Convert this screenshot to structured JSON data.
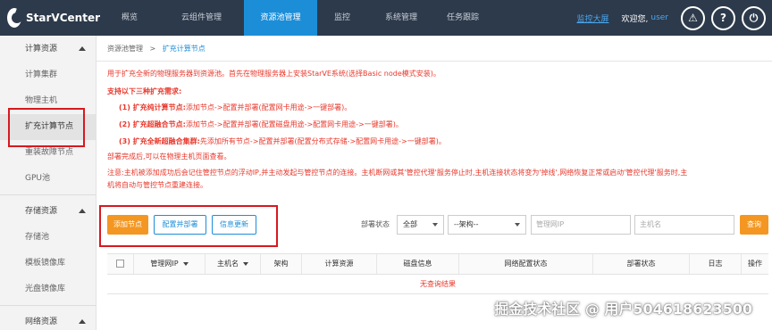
{
  "app": {
    "name": "StarVCenter"
  },
  "nav": [
    "概览",
    "云组件管理",
    "资源池管理",
    "监控",
    "系统管理",
    "任务跟踪"
  ],
  "nav_active_index": 2,
  "header": {
    "screen_link": "监控大屏",
    "welcome": "欢迎您,",
    "user": "user",
    "alert_glyph": "⚠",
    "help_glyph": "?",
    "power_glyph": "⏻"
  },
  "sidebar": {
    "groups": [
      {
        "title": "计算资源",
        "items": [
          "计算集群",
          "物理主机",
          "扩充计算节点",
          "重装故障节点",
          "GPU池"
        ]
      },
      {
        "title": "存储资源",
        "items": [
          "存储池",
          "模板镜像库",
          "光盘镜像库"
        ]
      },
      {
        "title": "网络资源",
        "items": []
      }
    ],
    "active_item": "扩充计算节点"
  },
  "breadcrumb": {
    "root": "资源池管理",
    "sep": ">",
    "current": "扩充计算节点"
  },
  "notes": {
    "intro": "用于扩充全新的物理服务器到资源池。首先在物理服务器上安装StarVE系统(选择Basic node模式安装)。",
    "support": "支持以下三种扩充需求:",
    "items": [
      {
        "label": "(1) 扩充纯计算节点:",
        "text": "添加节点->配置并部署(配置网卡用途->一键部署)。"
      },
      {
        "label": "(2) 扩充超融合节点:",
        "text": "添加节点->配置并部署(配置磁盘用途->配置网卡用途->一键部署)。"
      },
      {
        "label": "(3) 扩充全新超融合集群:",
        "text": "先添加所有节点->配置并部署(配置分布式存储->配置网卡用途->一键部署)。"
      }
    ],
    "after": "部署完成后,可以在物理主机页面查看。",
    "attention_1": "注意:主机被添加成功后会记住管控节点的浮动IP,并主动发起与管控节点的连接。主机断网或其'管控代理'服务停止时,主机连接状态将变为'掉线',网络恢复正常或启动'管控代理'服务时,主",
    "attention_2": "机将自动与管控节点重建连接。"
  },
  "toolbar": {
    "add_label": "添加节点",
    "deploy_label": "配置并部署",
    "refresh_label": "信息更新",
    "status_label": "部署状态",
    "status_value": "全部",
    "arch_value": "--架构--",
    "ip_placeholder": "管理网IP",
    "host_placeholder": "主机名",
    "search_label": "查询"
  },
  "table": {
    "columns": [
      "管理网IP",
      "主机名",
      "架构",
      "计算资源",
      "磁盘信息",
      "网络配置状态",
      "部署状态",
      "日志",
      "操作"
    ],
    "empty_text": "无查询结果"
  },
  "watermark": "掘金技术社区 @ 用户504618623500",
  "colors": {
    "topbar": "#2d3a4b",
    "accent": "#1c8ed8",
    "warning_text": "#e8382c",
    "primary_button": "#f39722",
    "annotation_box": "#d7191f"
  }
}
